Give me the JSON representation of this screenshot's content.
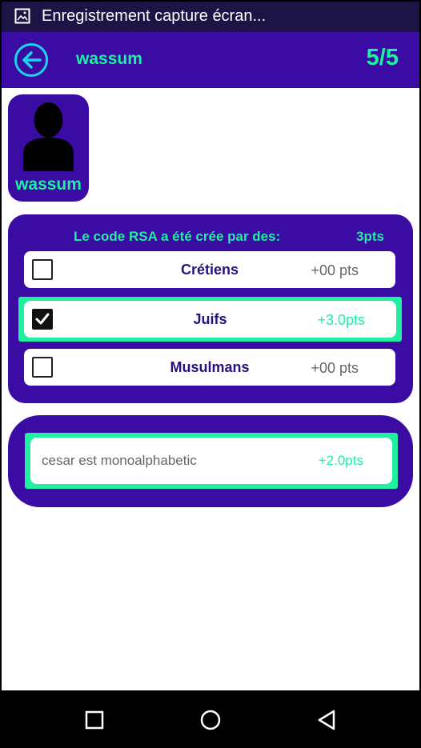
{
  "status_bar": {
    "notification_title": "Enregistrement capture écran...",
    "icon": "image-icon"
  },
  "app_bar": {
    "back_icon": "arrow-left-icon",
    "username": "wassum",
    "progress": "5/5"
  },
  "player": {
    "avatar_icon": "person-silhouette-icon",
    "name": "wassum"
  },
  "question": {
    "text": "Le code RSA a été crée par des:",
    "points": "3pts",
    "options": [
      {
        "label": "Crétiens",
        "score": "+00 pts",
        "checked": false
      },
      {
        "label": "Juifs",
        "score": "+3.0pts",
        "checked": true
      },
      {
        "label": "Musulmans",
        "score": "+00 pts",
        "checked": false
      }
    ]
  },
  "answer": {
    "text": "cesar est monoalphabetic",
    "score": "+2.0pts"
  },
  "nav_bar": {
    "recents_icon": "square-icon",
    "home_icon": "circle-icon",
    "back_icon": "triangle-back-icon"
  },
  "colors": {
    "primary": "#3a0ca3",
    "accent": "#1ff0a0",
    "back_ring": "#1ed2e8",
    "status_bar": "#1c1444"
  }
}
